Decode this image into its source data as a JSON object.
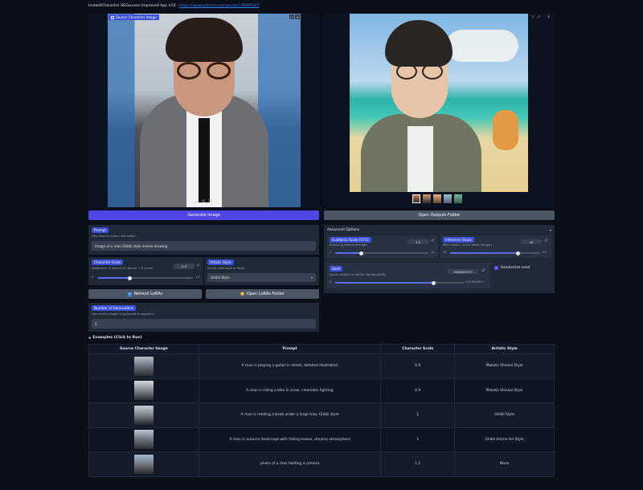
{
  "header": {
    "title": "InstantCharacter SECourses Improved App V10 - ",
    "link": "https://www.patreon.com/posts/126995127"
  },
  "source_panel": {
    "label": "Source Character Image"
  },
  "buttons": {
    "generate": "Generate Image",
    "open_outputs": "Open Outputs Folder",
    "refresh_loras": "Refresh LoRAs",
    "open_loras": "Open LoRAs Folder"
  },
  "prompt": {
    "label": "Prompt",
    "description": "Describe the scene and action",
    "value": "image of a man Ghibli style anime drawing"
  },
  "character_scale": {
    "label": "Character Scale",
    "description": "Adherence to source (0=ignore, 1.5=max)",
    "value": "0.5",
    "min": "0",
    "max": "1.5",
    "level": 0.33
  },
  "artistic_style": {
    "label": "Artistic Style",
    "description": "Select LoRA style or None",
    "value": "Ghibli Style"
  },
  "num_generations": {
    "label": "Number of Generations",
    "description": "How many images to generate in sequence",
    "value": "5"
  },
  "advanced": {
    "title": "Advanced Options",
    "guidance": {
      "label": "Guidance Scale (CFG)",
      "description": "Prompt guidance strength",
      "value": "3.5",
      "min": "1",
      "max": "10",
      "level": 0.28
    },
    "steps": {
      "label": "Inference Steps",
      "description": "More steps = more detail (longer)",
      "value": "40",
      "min": "10",
      "max": "50",
      "level": 0.75
    },
    "seed": {
      "label": "Seed",
      "description": "Leave random or set for reproducibility",
      "value": "1626609527",
      "min": "0",
      "max": "2147483647",
      "level": 0.76
    },
    "randomize": {
      "label": "Randomize seed",
      "checked": true
    }
  },
  "examples": {
    "title": "Examples (Click to Run)",
    "columns": [
      "Source Character Image",
      "Prompt",
      "Character Scale",
      "Artistic Style"
    ],
    "rows": [
      {
        "prompt": "A man is playing a guitar in street, detailed illustration",
        "scale": "0.9",
        "style": "Makoto Shinkai Style"
      },
      {
        "prompt": "A man is riding a bike in snow, cinematic lighting",
        "scale": "0.9",
        "style": "Makoto Shinkai Style"
      },
      {
        "prompt": "A man is reading a book under a large tree, Ghibli style",
        "scale": "1",
        "style": "Ghibli Style"
      },
      {
        "prompt": "A man in autumn landscape with falling leaves, dreamy atmosphere",
        "scale": "1",
        "style": "Ghibli Anime Art Style"
      },
      {
        "prompt": "photo of a man holding a camera",
        "scale": "1.1",
        "style": "None"
      }
    ]
  },
  "colors": {
    "background": "#0b0f19",
    "panel": "#1f2937",
    "accent": "#4f46e5",
    "label_tag": "#3b4fd8",
    "secondary_button": "#4b5563"
  },
  "icons": [
    "image-icon",
    "fullscreen-icon",
    "close-icon",
    "download-icon",
    "share-icon",
    "copy-icon",
    "reset-icon",
    "refresh-icon",
    "folder-icon",
    "chevron-down-icon",
    "checkbox-icon"
  ]
}
